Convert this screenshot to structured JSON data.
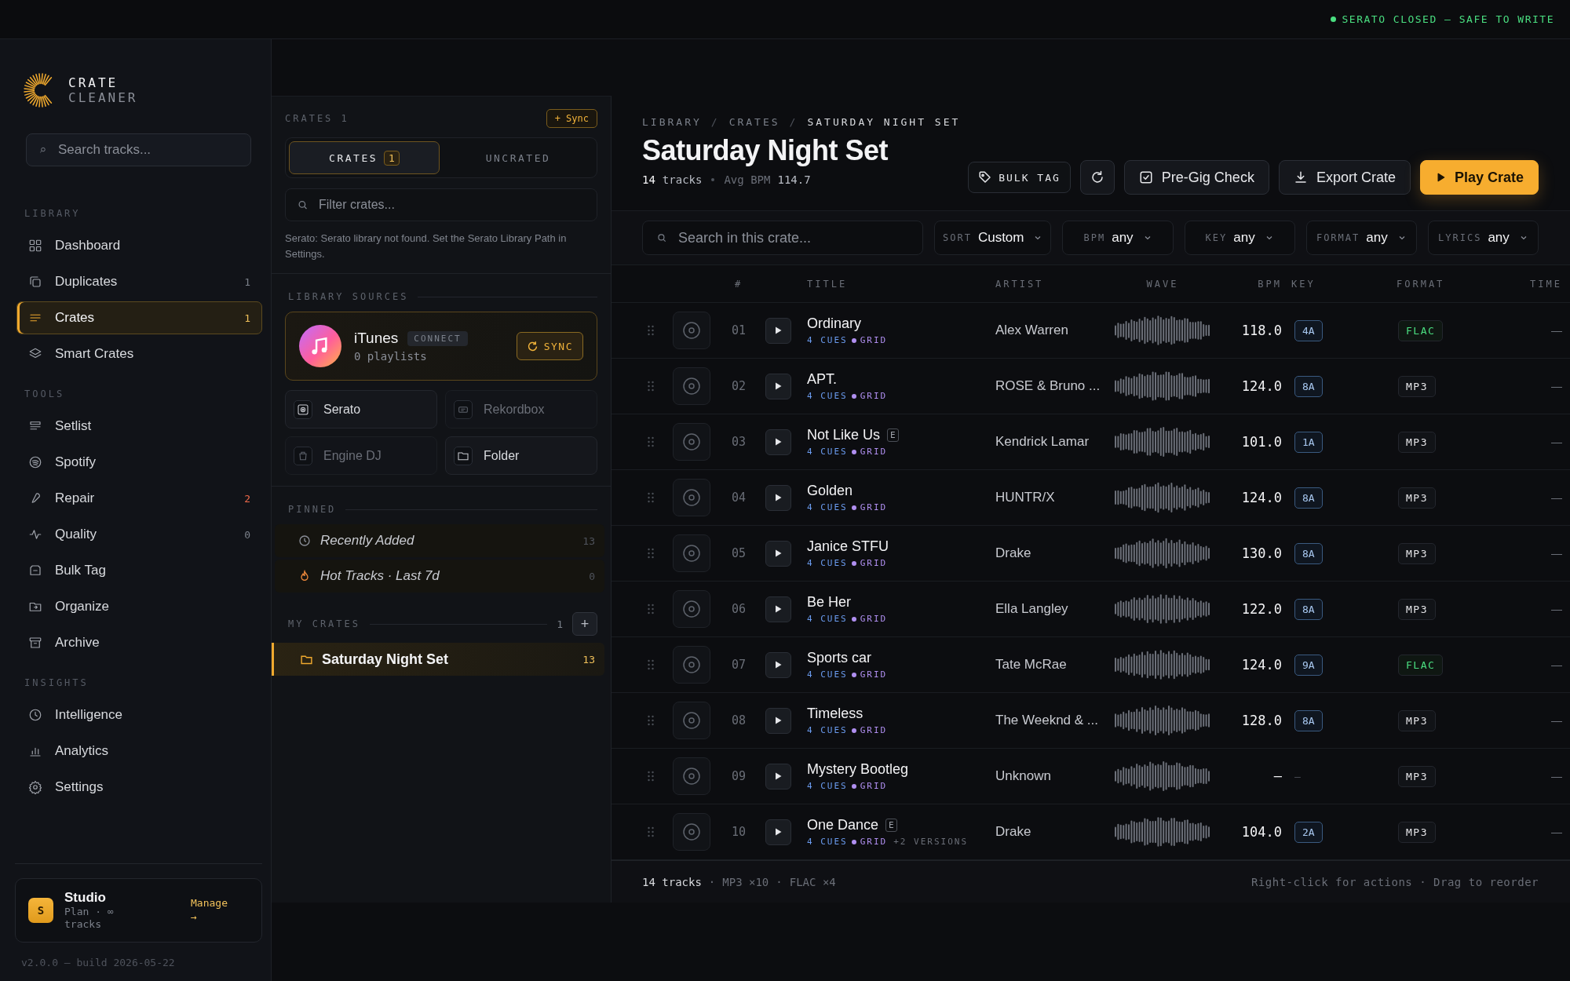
{
  "status": {
    "text": "SERATO CLOSED — SAFE TO WRITE",
    "color": "#4ade80"
  },
  "brand": {
    "line1": "CRATE",
    "line2": "CLEANER"
  },
  "sidebar": {
    "search": {
      "placeholder": "Search tracks..."
    },
    "sections": [
      {
        "label": "LIBRARY",
        "items": [
          {
            "label": "Dashboard",
            "selected": false
          },
          {
            "label": "Duplicates",
            "count": "1",
            "alert": false,
            "selected": false
          },
          {
            "label": "Crates",
            "count": "1",
            "alert": false,
            "selected": true
          },
          {
            "label": "Smart Crates",
            "selected": false
          }
        ]
      },
      {
        "label": "TOOLS",
        "items": [
          {
            "label": "Setlist",
            "selected": false
          },
          {
            "label": "Spotify",
            "selected": false
          },
          {
            "label": "Repair",
            "count": "2",
            "alert": true,
            "selected": false
          },
          {
            "label": "Quality",
            "count": "0",
            "alert": false,
            "selected": false
          },
          {
            "label": "Bulk Tag",
            "selected": false
          },
          {
            "label": "Organize",
            "selected": false
          },
          {
            "label": "Archive",
            "selected": false
          }
        ]
      },
      {
        "label": "INSIGHTS",
        "items": [
          {
            "label": "Intelligence",
            "selected": false
          },
          {
            "label": "Analytics",
            "selected": false
          },
          {
            "label": "Settings",
            "selected": false
          }
        ]
      }
    ],
    "plan": {
      "avatar": "S",
      "name": "Studio",
      "detail": "Plan · ∞ tracks",
      "action": "Manage →"
    },
    "version": "v2.0.0 — build 2026-05-22"
  },
  "crates_panel": {
    "title": "CRATES 1",
    "sync_button": "+ Sync",
    "tabs": [
      {
        "label": "CRATES",
        "badge": "1",
        "selected": true
      },
      {
        "label": "UNCRATED",
        "selected": false
      }
    ],
    "filter": {
      "placeholder": "Filter crates..."
    },
    "notice": "Serato: Serato library not found. Set the Serato Library Path in Settings.",
    "sources_label": "LIBRARY SOURCES",
    "itunes": {
      "name": "iTunes",
      "badge": "CONNECT",
      "detail": "0 playlists",
      "button": "SYNC"
    },
    "sources": [
      {
        "label": "Serato",
        "disabled": false
      },
      {
        "label": "Rekordbox",
        "disabled": true
      },
      {
        "label": "Engine DJ",
        "disabled": true
      },
      {
        "label": "Folder",
        "disabled": false
      }
    ],
    "pinned_label": "PINNED",
    "pinned": [
      {
        "label": "Recently Added",
        "count": "13"
      },
      {
        "label": "Hot Tracks · Last 7d",
        "count": "0"
      }
    ],
    "my_crates_label": "MY CRATES",
    "my_crates_count": "1",
    "add_button": "+",
    "crates": [
      {
        "label": "Saturday Night Set",
        "count": "13",
        "selected": true
      }
    ]
  },
  "main": {
    "breadcrumb": [
      "LIBRARY",
      "CRATES",
      "SATURDAY NIGHT SET"
    ],
    "breadcrumb_separator": "/",
    "title": "Saturday Night Set",
    "track_count": "14",
    "track_label": "tracks",
    "avg_label": "Avg BPM",
    "avg_value": "114.7",
    "actions": [
      {
        "kind": "tag",
        "label": "BULK TAG"
      },
      {
        "kind": "refresh"
      },
      {
        "kind": "check",
        "label": "Pre-Gig Check"
      },
      {
        "kind": "export",
        "label": "Export Crate"
      },
      {
        "kind": "play",
        "label": "Play Crate"
      }
    ],
    "search": {
      "placeholder": "Search in this crate..."
    },
    "filters": [
      {
        "label": "SORT",
        "value": "Custom"
      },
      {
        "label": "BPM",
        "value": "any"
      },
      {
        "label": "KEY",
        "value": "any"
      },
      {
        "label": "FORMAT",
        "value": "any"
      },
      {
        "label": "LYRICS",
        "value": "any"
      }
    ],
    "table": {
      "columns": {
        "num": "#",
        "title": "TITLE",
        "artist": "ARTIST",
        "wave": "WAVE",
        "bpm": "BPM",
        "key": "KEY",
        "format": "FORMAT",
        "time": "TIME"
      },
      "rows": [
        {
          "num": "01",
          "title": "Ordinary",
          "cues": "4 CUES",
          "grid": "GRID",
          "artist": "Alex Warren",
          "bpm": "118.0",
          "key": "4A",
          "key_boxed": true,
          "format": "FLAC",
          "lossless": true,
          "time": "—"
        },
        {
          "num": "02",
          "title": "APT.",
          "cues": "4 CUES",
          "grid": "GRID",
          "artist": "ROSE & Bruno ...",
          "bpm": "124.0",
          "key": "8A",
          "key_boxed": true,
          "format": "MP3",
          "lossless": false,
          "time": "—"
        },
        {
          "num": "03",
          "title": "Not Like Us",
          "flag": "E",
          "cues": "4 CUES",
          "grid": "GRID",
          "artist": "Kendrick Lamar",
          "bpm": "101.0",
          "key": "1A",
          "key_boxed": true,
          "format": "MP3",
          "lossless": false,
          "time": "—"
        },
        {
          "num": "04",
          "title": "Golden",
          "cues": "4 CUES",
          "grid": "GRID",
          "artist": "HUNTR/X",
          "bpm": "124.0",
          "key": "8A",
          "key_boxed": true,
          "format": "MP3",
          "lossless": false,
          "time": "—"
        },
        {
          "num": "05",
          "title": "Janice STFU",
          "cues": "4 CUES",
          "grid": "GRID",
          "artist": "Drake",
          "bpm": "130.0",
          "key": "8A",
          "key_boxed": true,
          "format": "MP3",
          "lossless": false,
          "time": "—"
        },
        {
          "num": "06",
          "title": "Be Her",
          "cues": "4 CUES",
          "grid": "GRID",
          "artist": "Ella Langley",
          "bpm": "122.0",
          "key": "8A",
          "key_boxed": true,
          "format": "MP3",
          "lossless": false,
          "time": "—"
        },
        {
          "num": "07",
          "title": "Sports car",
          "cues": "4 CUES",
          "grid": "GRID",
          "artist": "Tate McRae",
          "bpm": "124.0",
          "key": "9A",
          "key_boxed": true,
          "format": "FLAC",
          "lossless": true,
          "time": "—"
        },
        {
          "num": "08",
          "title": "Timeless",
          "cues": "4 CUES",
          "grid": "GRID",
          "artist": "The Weeknd & ...",
          "bpm": "128.0",
          "key": "8A",
          "key_boxed": true,
          "format": "MP3",
          "lossless": false,
          "time": "—"
        },
        {
          "num": "09",
          "title": "Mystery Bootleg",
          "cues": "4 CUES",
          "grid": "GRID",
          "artist": "Unknown",
          "bpm": "—",
          "key": "—",
          "key_boxed": false,
          "format": "MP3",
          "lossless": false,
          "time": "—"
        },
        {
          "num": "10",
          "title": "One Dance",
          "flag": "E",
          "cues": "4 CUES",
          "grid": "GRID",
          "extra": "+2 VERSIONS",
          "artist": "Drake",
          "bpm": "104.0",
          "key": "2A",
          "key_boxed": true,
          "format": "MP3",
          "lossless": false,
          "time": "—"
        }
      ]
    },
    "footer": {
      "count": "14 tracks",
      "parts": [
        "MP3 ×10",
        "FLAC ×4"
      ],
      "separator": "·",
      "hint": "Right-click for actions · Drag to reorder"
    }
  }
}
